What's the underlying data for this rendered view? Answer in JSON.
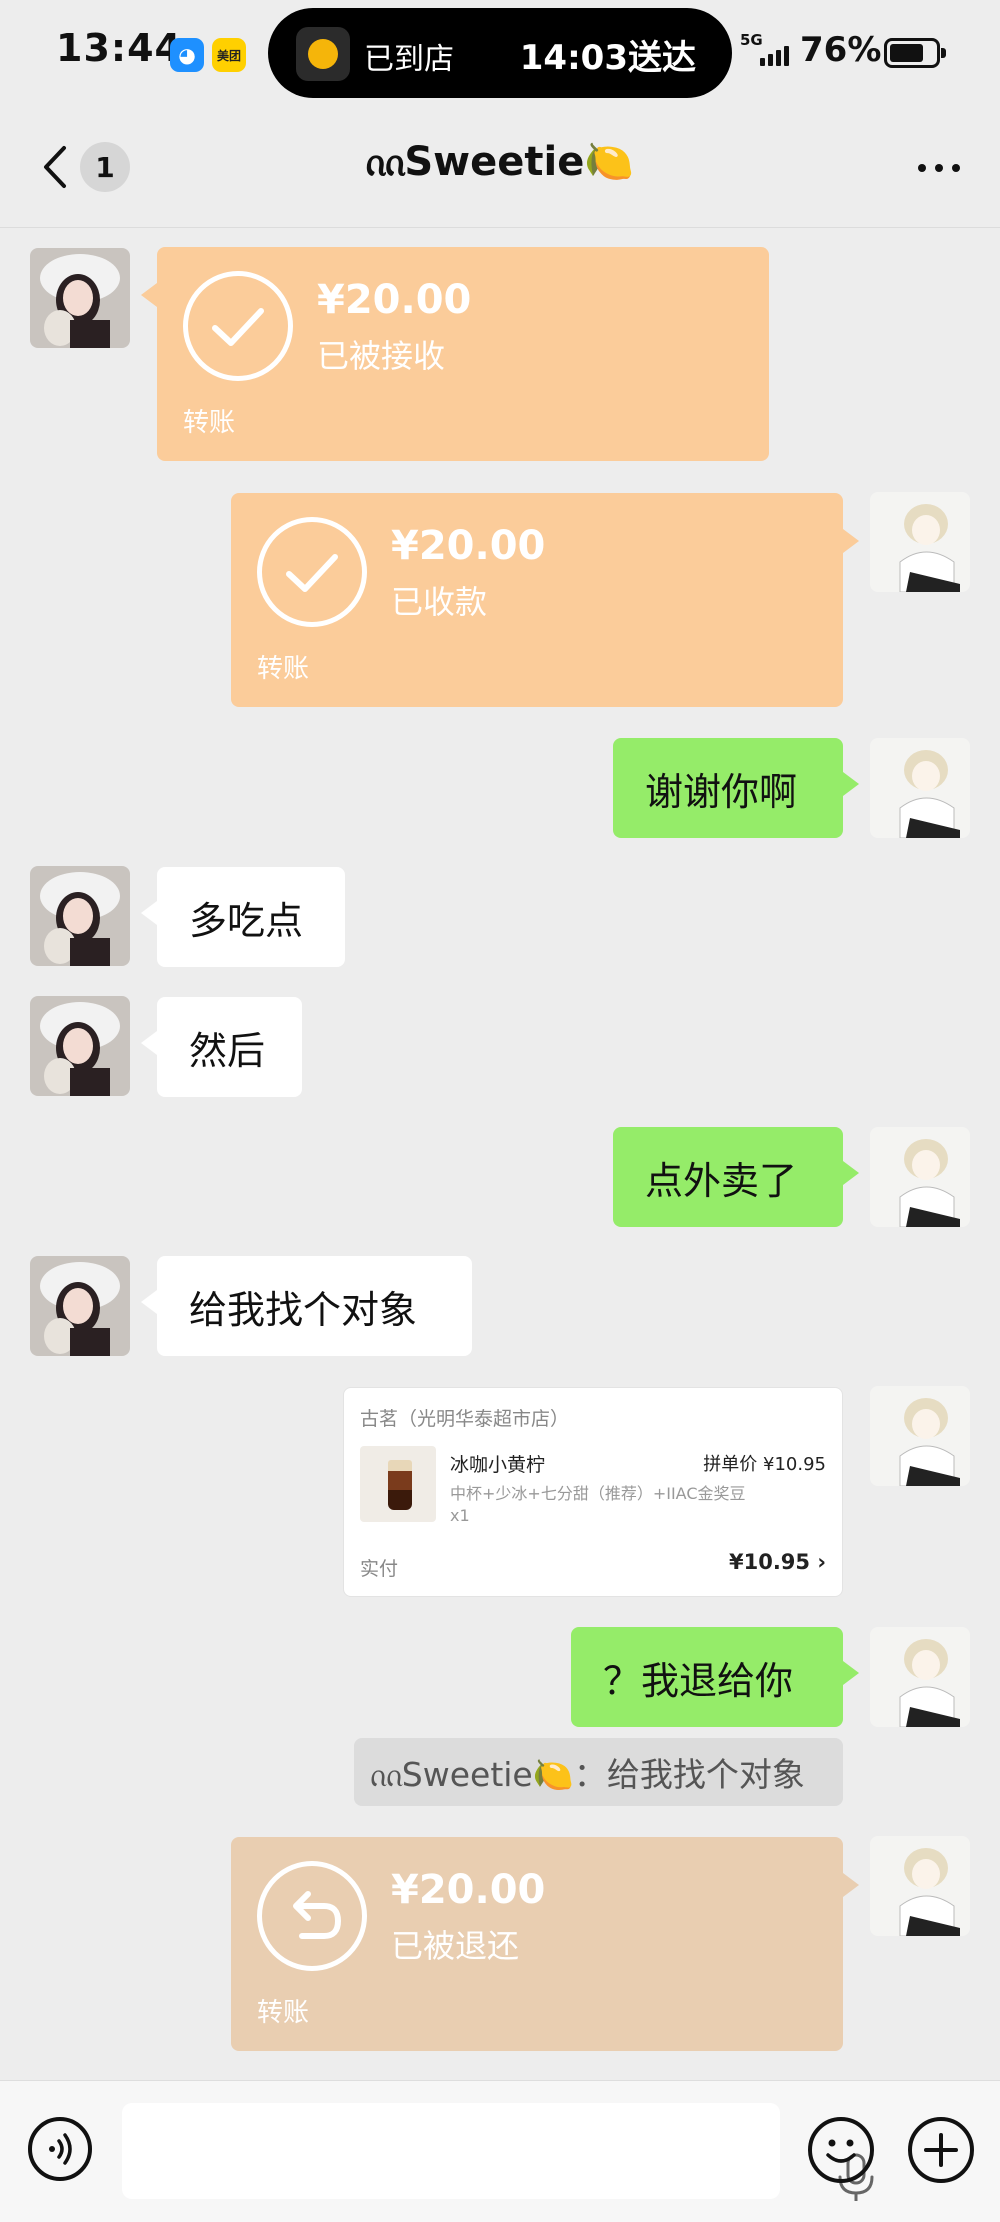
{
  "status_bar": {
    "time": "13:44",
    "app_icon_left": "blue-bear-icon",
    "app_icon_right_label": "美团",
    "live_activity": {
      "state": "已到店",
      "eta": "14:03送达"
    },
    "network": "5G",
    "battery_percent": "76%",
    "battery_level": 0.76
  },
  "nav": {
    "back_icon": "chevron-left-icon",
    "unread_count": "1",
    "title": "ᦶSweetie🍋",
    "more_icon": "more-dots-icon"
  },
  "messages": [
    {
      "id": "m1",
      "side": "left",
      "type": "transfer",
      "amount": "¥20.00",
      "status": "已被接收",
      "label": "转账",
      "icon": "check-icon"
    },
    {
      "id": "m2",
      "side": "right",
      "type": "transfer",
      "amount": "¥20.00",
      "status": "已收款",
      "label": "转账",
      "icon": "check-icon"
    },
    {
      "id": "m3",
      "side": "right",
      "type": "text",
      "text": "谢谢你啊"
    },
    {
      "id": "m4",
      "side": "left",
      "type": "text",
      "text": "多吃点"
    },
    {
      "id": "m5",
      "side": "left",
      "type": "text",
      "text": "然后"
    },
    {
      "id": "m6",
      "side": "right",
      "type": "text",
      "text": "点外卖了"
    },
    {
      "id": "m7",
      "side": "left",
      "type": "text",
      "text": "给我找个对象"
    },
    {
      "id": "m8",
      "side": "right",
      "type": "order_card",
      "store": "古茗（光明华泰超市店）",
      "product": "冰咖小黄柠",
      "price": "拼单价 ¥10.95",
      "spec": "中杯+少冰+七分甜（推荐）+IIAC金奖豆",
      "qty": "x1",
      "paid_label": "实付",
      "paid_amount": "¥10.95 ›"
    },
    {
      "id": "m9",
      "side": "right",
      "type": "text",
      "text": "？我退给你"
    },
    {
      "id": "m10",
      "side": "right",
      "type": "quote",
      "text": "ᦶSweetie🍋：给我找个对象"
    },
    {
      "id": "m11",
      "side": "right",
      "type": "transfer",
      "amount": "¥20.00",
      "status": "已被退还",
      "label": "转账",
      "icon": "return-arrow-icon"
    }
  ],
  "input_bar": {
    "voice_icon": "voice-icon",
    "mic_icon": "microphone-icon",
    "emoji_icon": "emoji-icon",
    "plus_icon": "plus-icon"
  },
  "colors": {
    "background": "#ededed",
    "green_bubble": "#95ec69",
    "white_bubble": "#ffffff",
    "transfer_orange": "#fbcc9a",
    "transfer_returned": "#e9ceb1"
  }
}
